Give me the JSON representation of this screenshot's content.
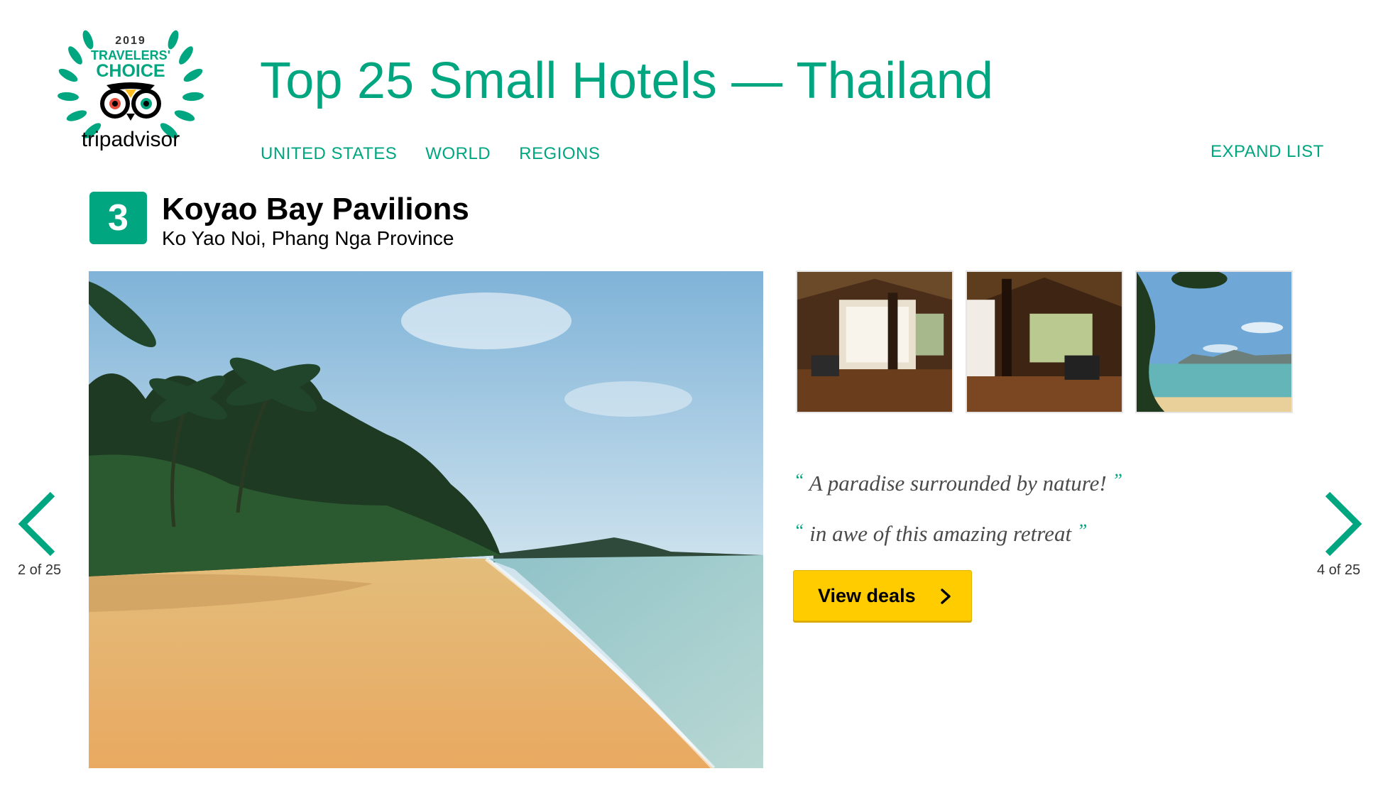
{
  "logo": {
    "year": "2019",
    "line1": "TRAVELERS'",
    "line2": "CHOICE",
    "brand": "tripadvisor"
  },
  "header": {
    "title": "Top 25 Small Hotels — Thailand",
    "nav": [
      {
        "label": "UNITED STATES"
      },
      {
        "label": "WORLD"
      },
      {
        "label": "REGIONS"
      }
    ],
    "expand_label": "EXPAND LIST"
  },
  "hotel": {
    "rank": "3",
    "name": "Koyao Bay Pavilions",
    "location": "Ko Yao Noi, Phang Nga Province"
  },
  "quotes": [
    {
      "open": "“",
      "text": "A paradise surrounded by nature!",
      "close": "”"
    },
    {
      "open": "“",
      "text": "in awe of this amazing retreat",
      "close": "”"
    }
  ],
  "deals": {
    "label": "View deals",
    "icon": "chevron-right-icon"
  },
  "pager": {
    "prev_label": "2 of 25",
    "next_label": "4 of 25",
    "prev_icon": "chevron-left-icon",
    "next_icon": "chevron-right-icon"
  },
  "colors": {
    "accent": "#00a680",
    "button": "#ffcc00",
    "quote_text": "#4a4a4a"
  }
}
